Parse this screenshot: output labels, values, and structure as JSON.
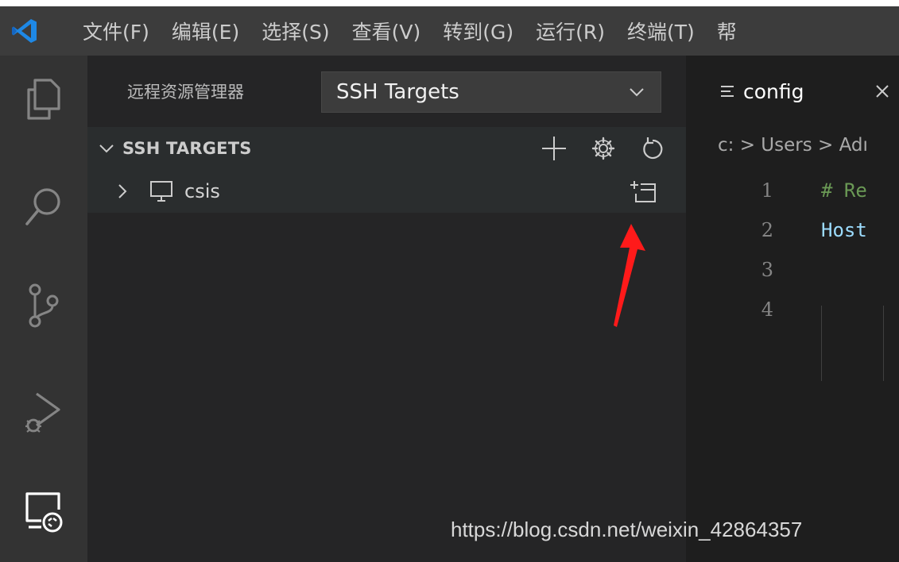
{
  "menu": {
    "items": [
      "文件(F)",
      "编辑(E)",
      "选择(S)",
      "查看(V)",
      "转到(G)",
      "运行(R)",
      "终端(T)",
      "帮"
    ]
  },
  "activity_bar": {
    "icons": [
      "explorer-icon",
      "search-icon",
      "source-control-icon",
      "run-debug-icon",
      "remote-explorer-icon"
    ]
  },
  "sidebar": {
    "title": "远程资源管理器",
    "target_select": {
      "value": "SSH Targets"
    },
    "section": {
      "label": "SSH TARGETS",
      "actions": [
        "add-icon",
        "gear-icon",
        "refresh-icon"
      ]
    },
    "tree": [
      {
        "label": "csis",
        "action": "connect-in-new-window-icon"
      }
    ]
  },
  "editor": {
    "tab": {
      "name": "config"
    },
    "breadcrumb": "c: > Users > Adı",
    "lines": [
      {
        "no": "1",
        "text": "#  Re",
        "color": "#6a9955"
      },
      {
        "no": "2",
        "text": "Host",
        "color": "#9cdcfe"
      },
      {
        "no": "3",
        "text": "",
        "color": "#d4d4d4"
      },
      {
        "no": "4",
        "text": "",
        "color": "#d4d4d4"
      }
    ]
  },
  "annotation": {
    "arrow_color": "#ff1a1a"
  },
  "watermark": "https://blog.csdn.net/weixin_42864357",
  "colors": {
    "accent": "#007acc",
    "menubar": "#3c3c3c",
    "activity_bar": "#333333",
    "sidebar": "#252526",
    "editor": "#1e1e1e"
  }
}
